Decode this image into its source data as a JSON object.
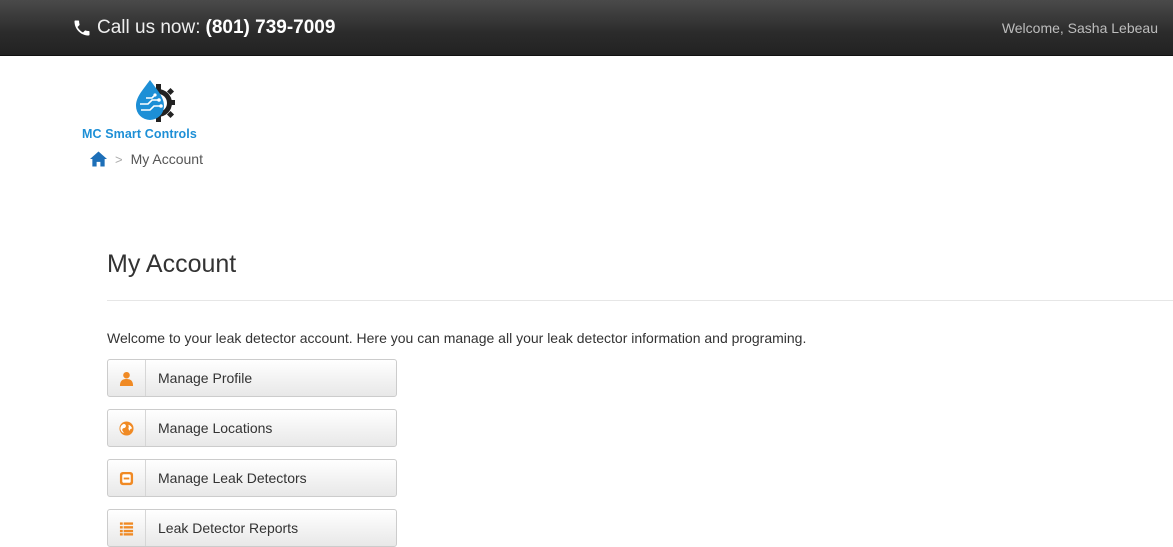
{
  "topbar": {
    "phone_label": "Call us now:",
    "phone_number": "(801) 739-7009",
    "welcome": "Welcome, Sasha Lebeau"
  },
  "logo": {
    "text": "MC Smart Controls"
  },
  "breadcrumb": {
    "separator": ">",
    "current": "My Account"
  },
  "page": {
    "title": "My Account",
    "intro": "Welcome to your leak detector account. Here you can manage all your leak detector information and programing."
  },
  "menu": {
    "items": [
      {
        "label": "Manage Profile",
        "icon": "user-icon"
      },
      {
        "label": "Manage Locations",
        "icon": "globe-icon"
      },
      {
        "label": "Manage Leak Detectors",
        "icon": "device-icon"
      },
      {
        "label": "Leak Detector Reports",
        "icon": "list-icon"
      }
    ]
  },
  "colors": {
    "topbar_bg": "#2b2b2b",
    "accent_orange": "#f08a24",
    "logo_blue": "#1d8fd6",
    "home_icon": "#1d6fb8"
  }
}
